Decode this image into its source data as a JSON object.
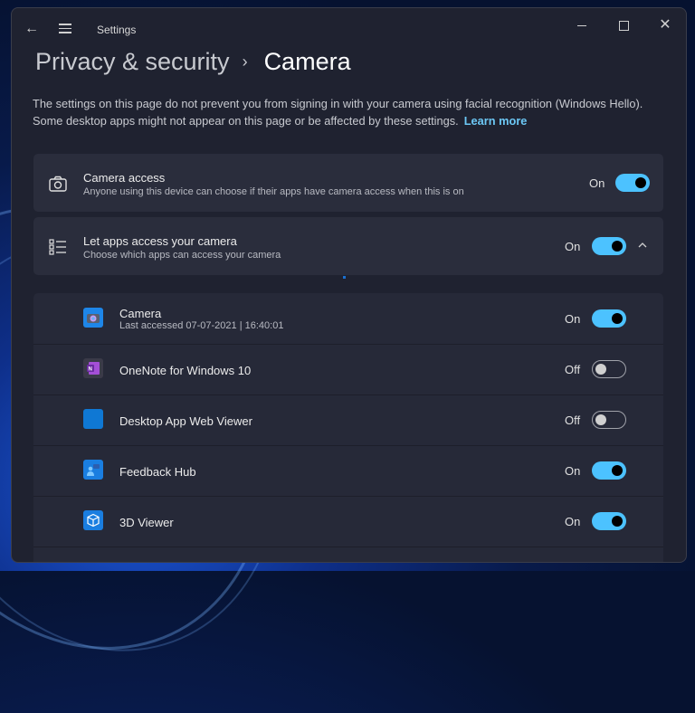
{
  "window": {
    "title": "Settings",
    "controls": {
      "minimize": "minimize",
      "maximize": "maximize",
      "close": "close"
    }
  },
  "breadcrumb": {
    "parent": "Privacy & security",
    "separator": "›",
    "current": "Camera"
  },
  "intro": {
    "text": "The settings on this page do not prevent you from signing in with your camera using facial recognition (Windows Hello). Some desktop apps might not appear on this page or be affected by these settings.",
    "link": "Learn more"
  },
  "settings": [
    {
      "title": "Camera access",
      "subtitle": "Anyone using this device can choose if their apps have camera access when this is on",
      "state": "On",
      "icon": "camera-icon"
    },
    {
      "title": "Let apps access your camera",
      "subtitle": "Choose which apps can access your camera",
      "state": "On",
      "icon": "list-icon",
      "expanded": true
    }
  ],
  "apps": [
    {
      "name": "Camera",
      "subtitle": "Last accessed 07-07-2021  |  16:40:01",
      "state": "On",
      "icon": "camera-app-icon",
      "color": "#1e86e8"
    },
    {
      "name": "OneNote for Windows 10",
      "subtitle": "",
      "state": "Off",
      "icon": "onenote-icon",
      "color": "#8a3fc7"
    },
    {
      "name": "Desktop App Web Viewer",
      "subtitle": "",
      "state": "Off",
      "icon": "web-viewer-icon",
      "color": "#0f78d4"
    },
    {
      "name": "Feedback Hub",
      "subtitle": "",
      "state": "On",
      "icon": "feedback-hub-icon",
      "color": "#1a7ee0"
    },
    {
      "name": "3D Viewer",
      "subtitle": "",
      "state": "On",
      "icon": "3d-viewer-icon",
      "color": "#1a7ee0"
    }
  ],
  "colors": {
    "accent": "#4cc2ff",
    "link": "#6cc8f5",
    "window_bg": "#1f2230",
    "card_bg": "#2a2d3c"
  }
}
